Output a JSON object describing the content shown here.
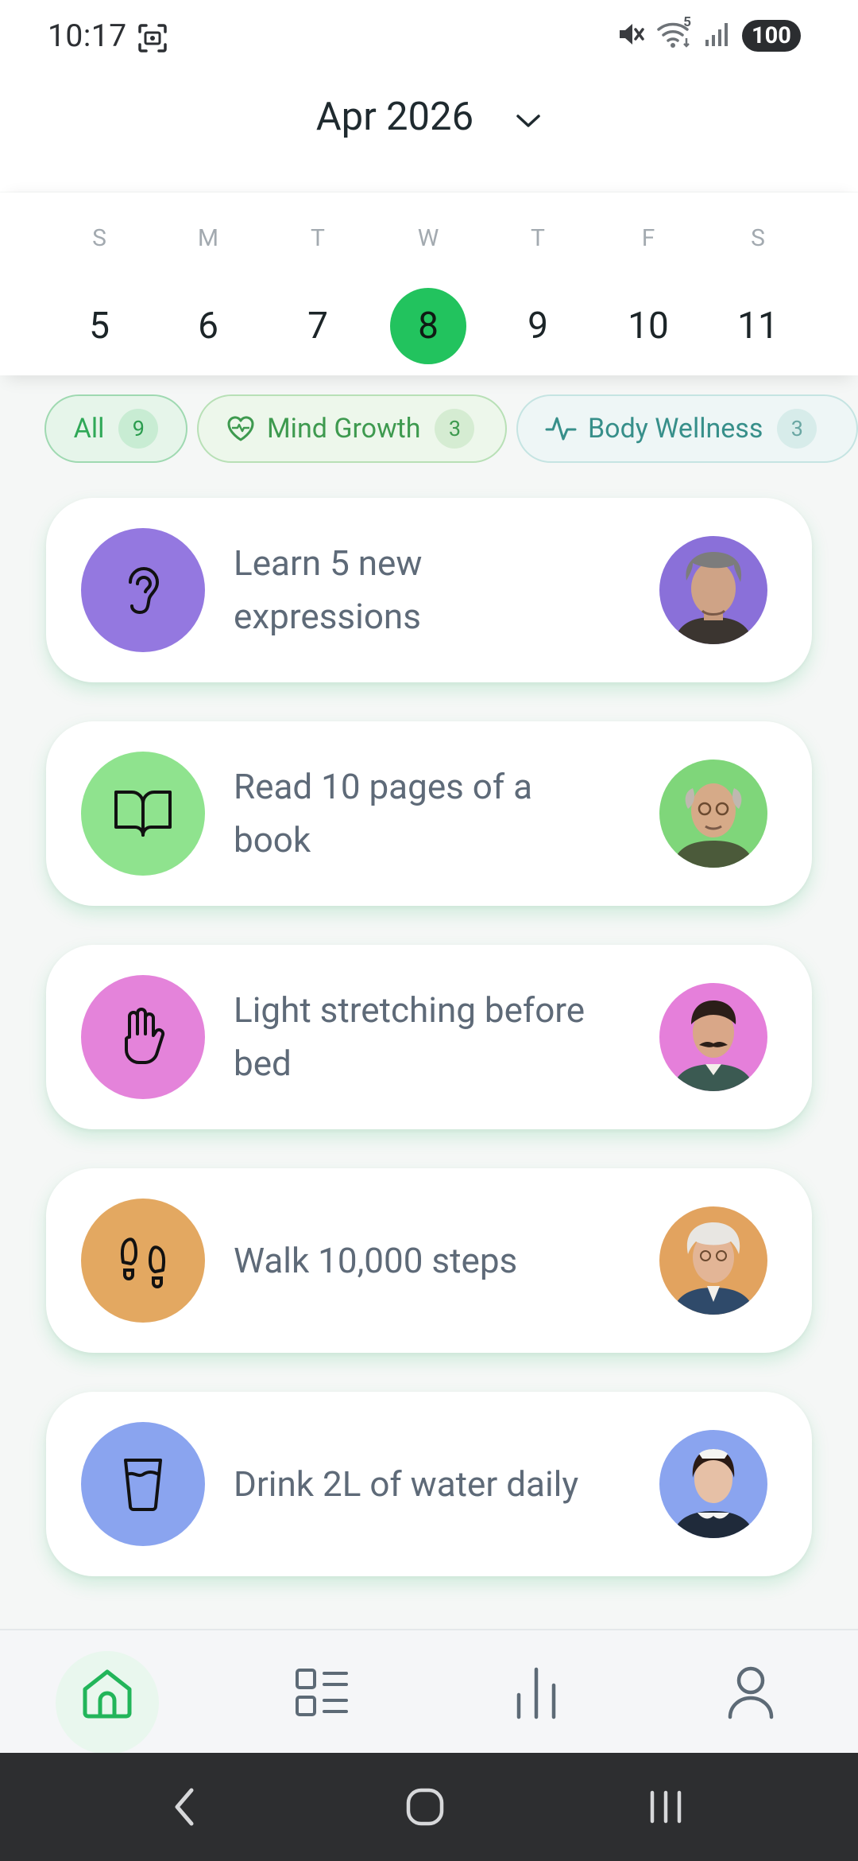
{
  "status_bar": {
    "time": "10:17",
    "battery": "100",
    "wifi_badge": "5"
  },
  "header": {
    "month_label": "Apr 2026"
  },
  "week": {
    "weekdays": [
      "S",
      "M",
      "T",
      "W",
      "T",
      "F",
      "S"
    ],
    "dates": [
      "5",
      "6",
      "7",
      "8",
      "9",
      "10",
      "11"
    ],
    "selected_index": 3,
    "selected_color": "#22c35e"
  },
  "filters": [
    {
      "label": "All",
      "count": "9"
    },
    {
      "label": "Mind Growth",
      "count": "3",
      "icon": "heart-pulse-icon"
    },
    {
      "label": "Body Wellness",
      "count": "3",
      "icon": "activity-icon"
    }
  ],
  "habits": [
    {
      "title": "Learn 5 new expressions",
      "icon": "ear-icon",
      "color": "#9478e0"
    },
    {
      "title": "Read 10 pages of a book",
      "icon": "book-open-icon",
      "color": "#8fe38e"
    },
    {
      "title": "Light stretching before bed",
      "icon": "hand-icon",
      "color": "#e483da"
    },
    {
      "title": "Walk 10,000 steps",
      "icon": "footprints-icon",
      "color": "#e3a861"
    },
    {
      "title": "Drink 2L of water daily",
      "icon": "glass-water-icon",
      "color": "#8aa4ef"
    }
  ],
  "bottom_nav": {
    "items": [
      "home-icon",
      "list-icon",
      "stats-icon",
      "profile-icon"
    ],
    "active": "home-icon",
    "accent": "#22b55a"
  }
}
